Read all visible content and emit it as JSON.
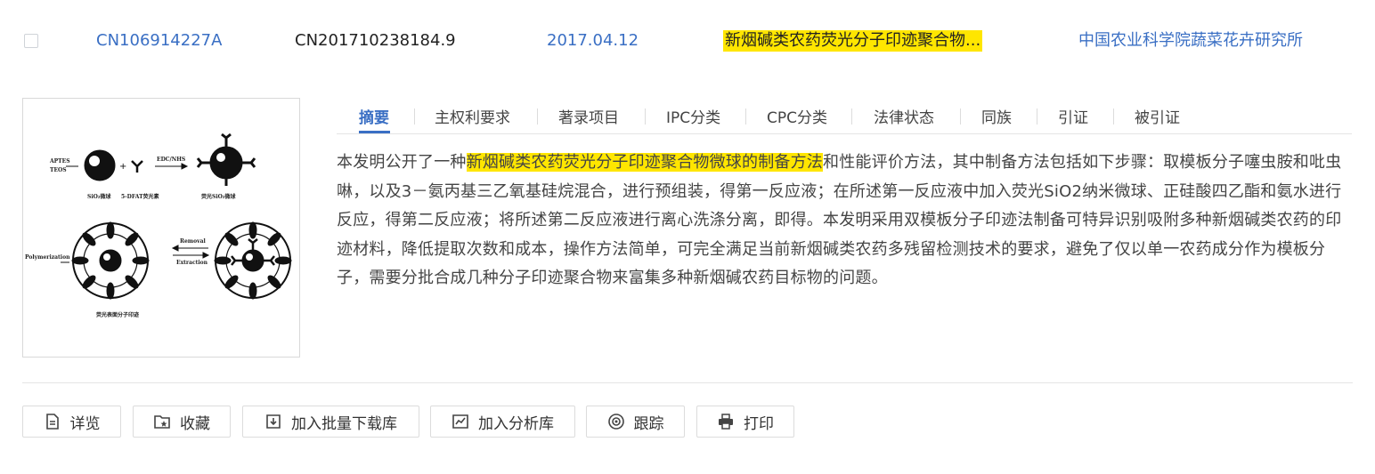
{
  "result_row": {
    "publication_number": "CN106914227A",
    "application_number": "CN201710238184.9",
    "date": "2017.04.12",
    "title": "新烟碱类农药荧光分子印迹聚合物...",
    "applicant": "中国农业科学院蔬菜花卉研究所"
  },
  "figure": {
    "label_aptes": "APTES",
    "label_teos": "TEOS",
    "label_sio2": "SiO₂微球",
    "label_template": "5-DFAT荧光素",
    "label_fsio2": "荧光SiO₂微球",
    "label_edc": "EDC/NHS",
    "label_polymerization": "Polymerization",
    "label_removal": "Removal",
    "label_extraction": "Extraction",
    "label_mip": "荧光表面分子印迹"
  },
  "tabs": [
    {
      "label": "摘要",
      "active": true
    },
    {
      "label": "主权利要求"
    },
    {
      "label": "著录项目"
    },
    {
      "label": "IPC分类"
    },
    {
      "label": "CPC分类"
    },
    {
      "label": "法律状态"
    },
    {
      "label": "同族"
    },
    {
      "label": "引证"
    },
    {
      "label": "被引证"
    }
  ],
  "abstract": {
    "prefix": "本发明公开了一种",
    "highlight": "新烟碱类农药荧光分子印迹聚合物微球的制备方法",
    "rest": "和性能评价方法，其中制备方法包括如下步骤：取模板分子噻虫胺和吡虫啉，以及3－氨丙基三乙氧基硅烷混合，进行预组装，得第一反应液；在所述第一反应液中加入荧光SiO2纳米微球、正硅酸四乙酯和氨水进行反应，得第二反应液；将所述第二反应液进行离心洗涤分离，即得。本发明采用双模板分子印迹法制备可特异识别吸附多种新烟碱类农药的印迹材料，降低提取次数和成本，操作方法简单，可完全满足当前新烟碱类农药多残留检测技术的要求，避免了仅以单一农药成分作为模板分子，需要分批合成几种分子印迹聚合物来富集多种新烟碱农药目标物的问题。"
  },
  "actions": {
    "detail": "详览",
    "favorite": "收藏",
    "batch_download": "加入批量下载库",
    "analysis": "加入分析库",
    "track": "跟踪",
    "print": "打印"
  },
  "colors": {
    "link_blue": "#3a6fc4",
    "highlight": "#ffe600"
  }
}
